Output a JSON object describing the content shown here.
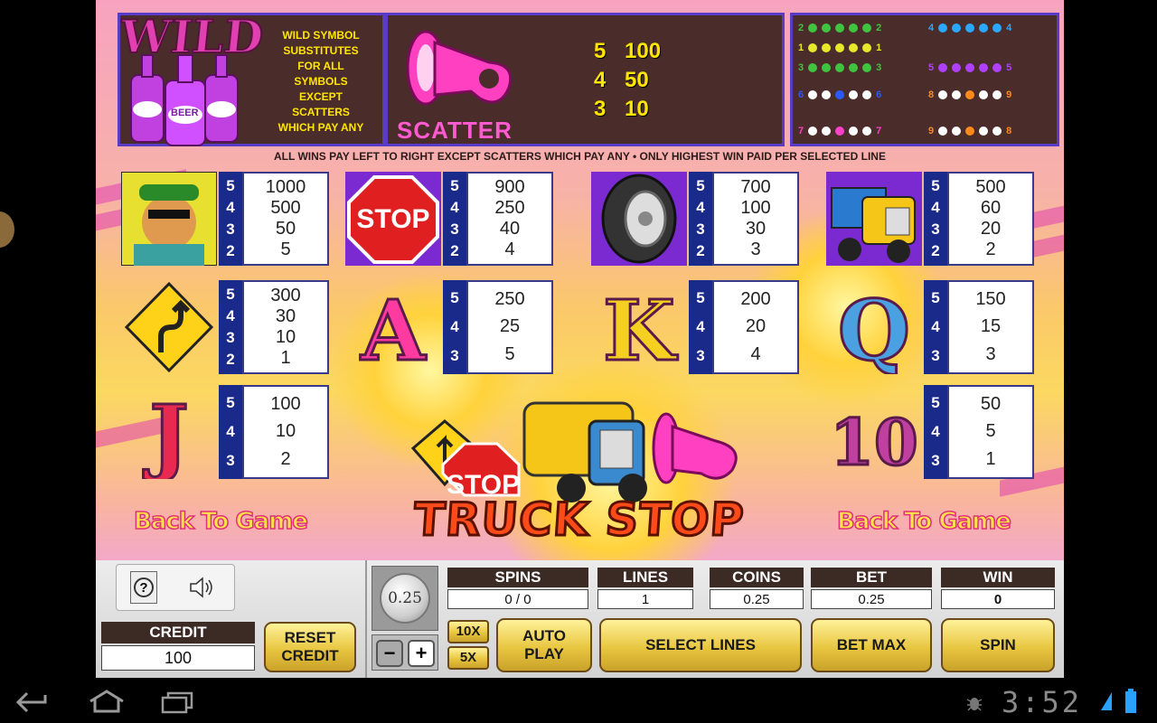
{
  "wild": {
    "title": "WILD",
    "bottle_label": "BEER",
    "text_lines": [
      "WILD SYMBOL",
      "SUBSTITUTES",
      "FOR ALL",
      "SYMBOLS",
      "EXCEPT",
      "SCATTERS",
      "WHICH PAY ANY"
    ]
  },
  "scatter": {
    "label": "SCATTER",
    "pays": [
      {
        "count": "5",
        "value": "100"
      },
      {
        "count": "4",
        "value": "50"
      },
      {
        "count": "3",
        "value": "10"
      }
    ]
  },
  "lines": {
    "rows": [
      {
        "start": "2",
        "end": "2",
        "color": "#3fc43f"
      },
      {
        "start": "1",
        "end": "1",
        "color": "#e8e82a"
      },
      {
        "start": "3",
        "end": "3",
        "color": "#3fc43f"
      },
      {
        "start": "4",
        "end": "4",
        "color": "#2aa8ff"
      },
      {
        "start": "5",
        "end": "5",
        "color": "#b040ff"
      },
      {
        "start": "6",
        "end": "6",
        "color": "#2a5aff"
      },
      {
        "start": "7",
        "end": "7",
        "color": "#ff40c8"
      },
      {
        "start": "8",
        "end": "9",
        "color": "#ff8a1a"
      },
      {
        "start": "9",
        "end": "8",
        "color": "#ff8a1a"
      }
    ]
  },
  "rule_text": "ALL WINS PAY LEFT TO RIGHT EXCEPT SCATTERS WHICH PAY ANY  •  ONLY HIGHEST WIN PAID PER SELECTED LINE",
  "paytable": [
    {
      "symbol": "trucker",
      "counts": [
        "5",
        "4",
        "3",
        "2"
      ],
      "pays": [
        "1000",
        "500",
        "50",
        "5"
      ]
    },
    {
      "symbol": "stop-sign",
      "sign_text": "STOP",
      "counts": [
        "5",
        "4",
        "3",
        "2"
      ],
      "pays": [
        "900",
        "250",
        "40",
        "4"
      ]
    },
    {
      "symbol": "tire",
      "counts": [
        "5",
        "4",
        "3",
        "2"
      ],
      "pays": [
        "700",
        "100",
        "30",
        "3"
      ]
    },
    {
      "symbol": "dump-truck",
      "counts": [
        "5",
        "4",
        "3",
        "2"
      ],
      "pays": [
        "500",
        "60",
        "20",
        "2"
      ]
    },
    {
      "symbol": "road-sign",
      "counts": [
        "5",
        "4",
        "3",
        "2"
      ],
      "pays": [
        "300",
        "30",
        "10",
        "1"
      ]
    },
    {
      "symbol": "A",
      "letter": "A",
      "counts": [
        "5",
        "4",
        "3"
      ],
      "pays": [
        "250",
        "25",
        "5"
      ]
    },
    {
      "symbol": "K",
      "letter": "K",
      "counts": [
        "5",
        "4",
        "3"
      ],
      "pays": [
        "200",
        "20",
        "4"
      ]
    },
    {
      "symbol": "Q",
      "letter": "Q",
      "counts": [
        "5",
        "4",
        "3"
      ],
      "pays": [
        "150",
        "15",
        "3"
      ]
    },
    {
      "symbol": "J",
      "letter": "J",
      "counts": [
        "5",
        "4",
        "3"
      ],
      "pays": [
        "100",
        "10",
        "2"
      ]
    },
    {
      "symbol": "10",
      "letter": "10",
      "counts": [
        "5",
        "4",
        "3"
      ],
      "pays": [
        "50",
        "5",
        "1"
      ]
    }
  ],
  "back_to_game": "Back To Game",
  "logo": {
    "line": "TRUCK STOP",
    "stop_text": "STOP"
  },
  "controls": {
    "credit_label": "CREDIT",
    "credit_value": "100",
    "reset_credit": "RESET\nCREDIT",
    "coin_value": "0.25",
    "minus": "−",
    "plus": "+",
    "x10": "10X",
    "x5": "5X",
    "auto_play": "AUTO\nPLAY",
    "select_lines": "SELECT LINES",
    "bet_max": "BET MAX",
    "spin": "SPIN",
    "fields": [
      {
        "label": "SPINS",
        "value": "0 / 0"
      },
      {
        "label": "LINES",
        "value": "1"
      },
      {
        "label": "COINS",
        "value": "0.25"
      },
      {
        "label": "BET",
        "value": "0.25"
      },
      {
        "label": "WIN",
        "value": "0"
      }
    ]
  },
  "statusbar": {
    "time": "3:52"
  },
  "colors": {
    "panel_border": "#5a3bc8",
    "count_col": "#1a2a8a",
    "pink": "#ff4ab8",
    "gold": "#e8c640"
  }
}
